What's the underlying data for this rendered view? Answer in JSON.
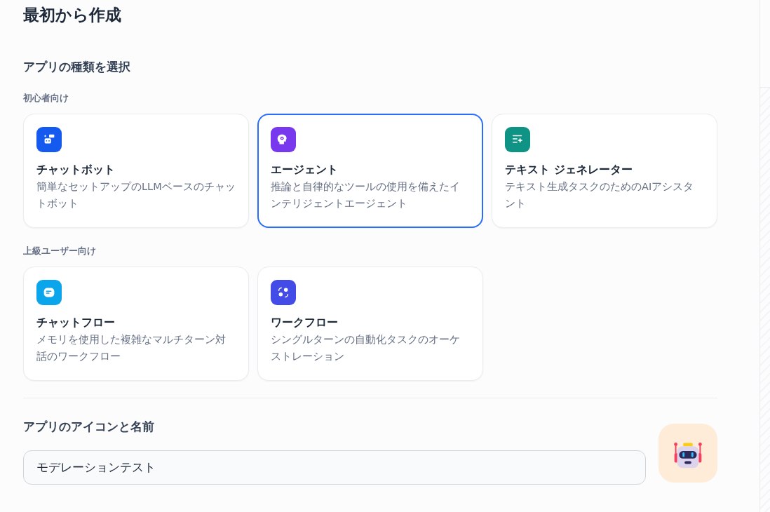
{
  "title": "最初から作成",
  "type_section": {
    "heading": "アプリの種類を選択",
    "groups": [
      {
        "label": "初心者向け",
        "items": [
          {
            "kind": "chatbot",
            "name": "チャットボット",
            "description": "簡単なセットアップのLLMベースのチャットボット",
            "color": "#155aef",
            "selected": false
          },
          {
            "kind": "agent",
            "name": "エージェント",
            "description": "推論と自律的なツールの使用を備えたインテリジェントエージェント",
            "color": "#7839ee",
            "selected": true
          },
          {
            "kind": "text",
            "name": "テキスト ジェネレーター",
            "description": "テキスト生成タスクのためのAIアシスタント",
            "color": "#0e9384",
            "selected": false
          }
        ]
      },
      {
        "label": "上級ユーザー向け",
        "items": [
          {
            "kind": "chatflow",
            "name": "チャットフロー",
            "description": "メモリを使用した複雑なマルチターン対話のワークフロー",
            "color": "#0ba5ec",
            "selected": false
          },
          {
            "kind": "workflow",
            "name": "ワークフロー",
            "description": "シングルターンの自動化タスクのオーケストレーション",
            "color": "#444ce7",
            "selected": false
          }
        ]
      }
    ]
  },
  "name_section": {
    "heading": "アプリのアイコンと名前",
    "value": "モデレーションテスト"
  }
}
